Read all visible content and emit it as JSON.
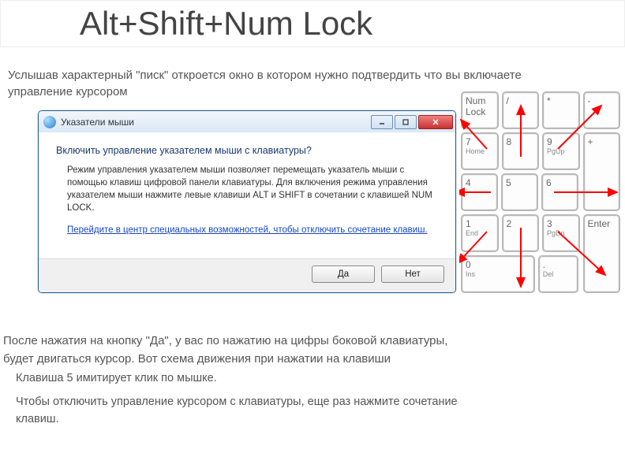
{
  "title": "Alt+Shift+Num Lock",
  "intro": "Услышав характерный \"писк\" откроется окно в котором нужно подтвердить что вы включаете управление курсором",
  "dialog": {
    "title": "Указатели мыши",
    "question": "Включить управление указателем мыши с клавиатуры?",
    "desc": "Режим управления указателем мыши позволяет перемещать указатель мыши с помощью клавиш цифровой панели клавиатуры.  Для включения режима управления указателем мыши нажмите левые клавиши ALT и SHIFT в сочетании с клавишей NUM LOCK.",
    "link": "Перейдите в центр специальных возможностей, чтобы отключить сочетание клавиш.",
    "yes": "Да",
    "no": "Нет"
  },
  "after": "После нажатия на кнопку \"Да\", у вас по нажатию на цифры боковой клавиатуры, будет двигаться курсор. Вот схема движения при нажатии на клавиши",
  "p5": "Клавиша 5 имитирует клик по мышке.",
  "poff": "Чтобы отключить управление курсором с клавиатуры, еще раз нажмите сочетание клавиш.",
  "keys": {
    "numlock": "Num Lock",
    "slash": "/",
    "star": "*",
    "minus": "-",
    "k7": "7",
    "k7s": "Home",
    "k8": "8",
    "k9": "9",
    "k9s": "PgUp",
    "plus": "+",
    "k4": "4",
    "k5": "5",
    "k6": "6",
    "k1": "1",
    "k1s": "End",
    "k2": "2",
    "k3": "3",
    "k3s": "PgDn",
    "enter": "Enter",
    "k0": "0",
    "k0s": "Ins",
    "dot": ".",
    "dots": "Del"
  }
}
